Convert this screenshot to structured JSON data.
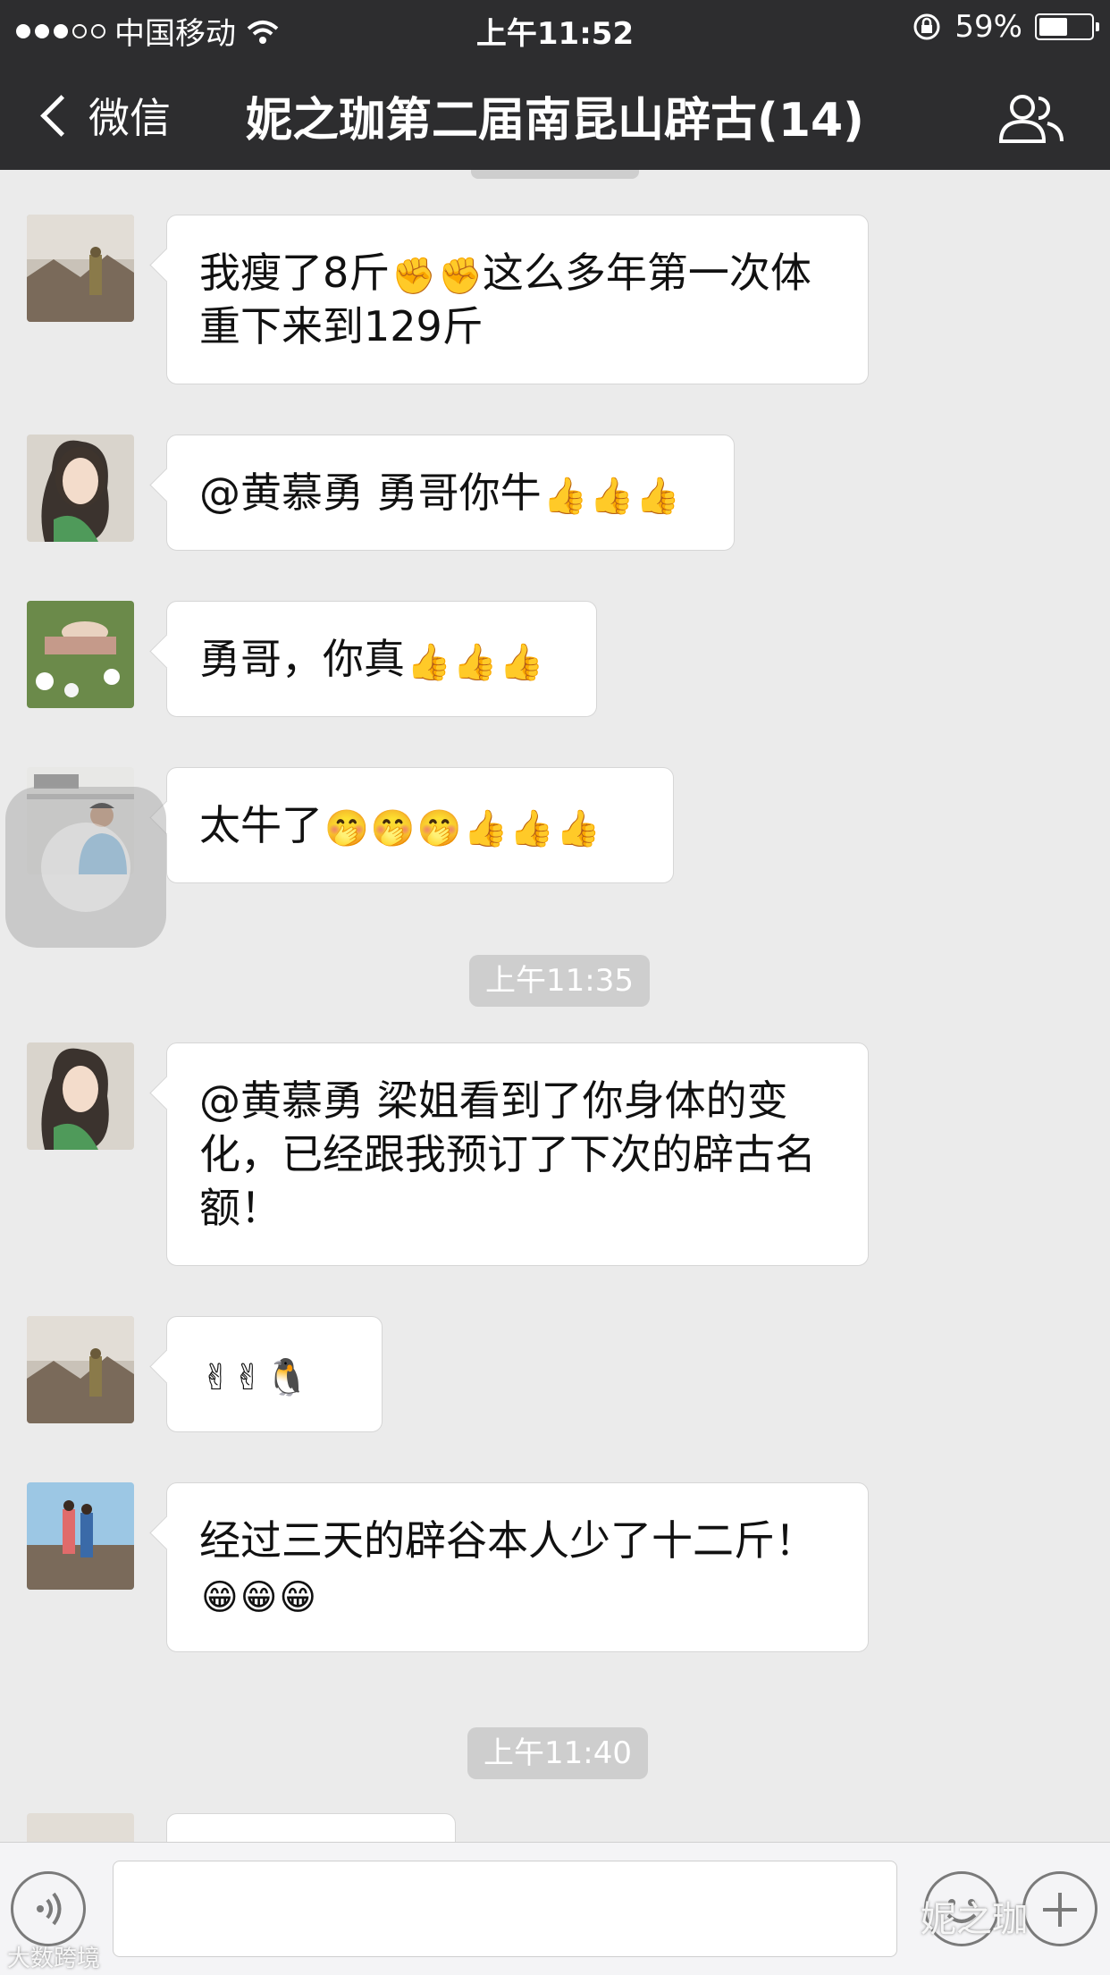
{
  "status_bar": {
    "carrier": "中国移动",
    "time": "上午11:52",
    "battery_percent_label": "59%",
    "battery_level": 0.59
  },
  "nav": {
    "back_label": "微信",
    "title": "妮之珈第二届南昆山辟古(14)",
    "members_icon": "group-members-icon"
  },
  "messages": [
    {
      "text": "我瘦了8斤",
      "emojis_mid": [
        "✊",
        "✊"
      ],
      "text_after": "这么多年第一次体重下来到129斤"
    },
    {
      "text": "@黄慕勇 勇哥你牛",
      "emojis": [
        "👍",
        "👍",
        "👍"
      ]
    },
    {
      "text": "勇哥，你真",
      "emojis": [
        "👍",
        "👍",
        "👍"
      ]
    },
    {
      "text": "太牛了",
      "emojis": [
        "🤭",
        "🤭",
        "🤭",
        "👍",
        "👍",
        "👍"
      ]
    },
    {
      "text": "@黄慕勇 梁姐看到了你身体的变化，已经跟我预订了下次的辟古名额！"
    },
    {
      "text": "",
      "emojis": [
        "✌",
        "✌",
        "🐧"
      ]
    },
    {
      "text": "经过三天的辟谷本人少了十二斤！",
      "emojis": [
        "😁",
        "😁",
        "😁"
      ]
    }
  ],
  "timestamps": [
    "上午11:35",
    "上午11:40"
  ],
  "watermarks": {
    "right": "妮之珈",
    "left": "大数跨境"
  },
  "colors": {
    "header": "#2d2d2f",
    "background": "#ebebeb",
    "bubble": "#ffffff",
    "timestamp_bg": "#cecece"
  }
}
